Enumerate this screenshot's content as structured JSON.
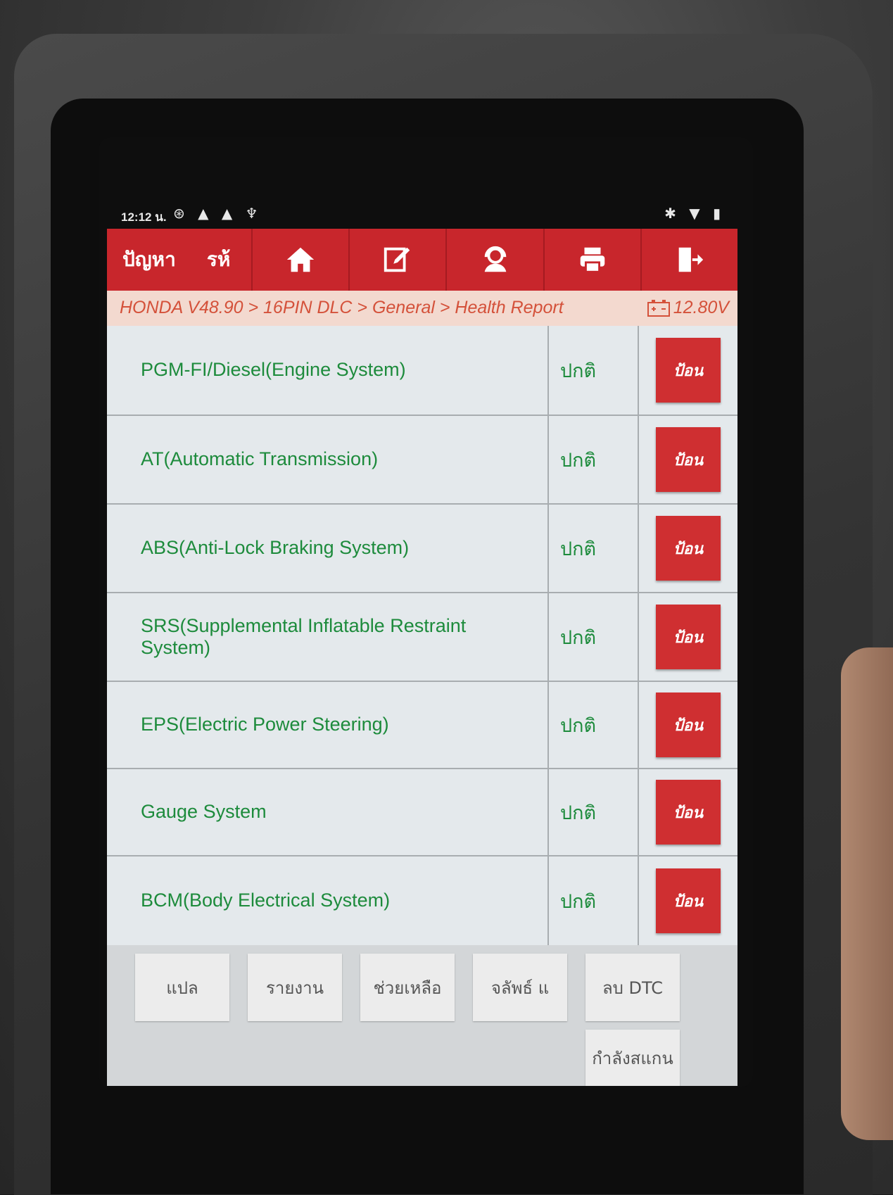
{
  "status_bar": {
    "time": "12:12 น.",
    "left_icons": "⊛ ▲ ▲ ♆",
    "right_icons": "✱ ▼ ▮"
  },
  "toolbar": {
    "title": "ปัญหา",
    "title_suffix": "รห้",
    "buttons": [
      {
        "icon": "home-icon"
      },
      {
        "icon": "edit-icon"
      },
      {
        "icon": "support-icon"
      },
      {
        "icon": "print-icon"
      },
      {
        "icon": "exit-icon"
      }
    ],
    "color": "#c8262c"
  },
  "breadcrumb": {
    "path": "HONDA V48.90 > 16PIN DLC > General > Health Report",
    "voltage": "12.80V"
  },
  "systems": [
    {
      "name": "PGM-FI/Diesel(Engine System)",
      "status": "ปกติ",
      "action": "ป้อน"
    },
    {
      "name": "AT(Automatic Transmission)",
      "status": "ปกติ",
      "action": "ป้อน"
    },
    {
      "name": "ABS(Anti-Lock Braking System)",
      "status": "ปกติ",
      "action": "ป้อน"
    },
    {
      "name": "SRS(Supplemental Inflatable Restraint System)",
      "status": "ปกติ",
      "action": "ป้อน"
    },
    {
      "name": "EPS(Electric Power Steering)",
      "status": "ปกติ",
      "action": "ป้อน"
    },
    {
      "name": "Gauge System",
      "status": "ปกติ",
      "action": "ป้อน"
    },
    {
      "name": "BCM(Body Electrical System)",
      "status": "ปกติ",
      "action": "ป้อน"
    }
  ],
  "actions": {
    "translate": "แปล",
    "report": "รายงาน",
    "help": "ช่วยเหลือ",
    "results": "จลัพธ์ แ",
    "clear_dtc": "ลบ DTC",
    "scanning": "กำลังสแกน"
  },
  "nav": {
    "back": "◀",
    "home": "●",
    "recents": "■",
    "screenshot": "⧉"
  }
}
